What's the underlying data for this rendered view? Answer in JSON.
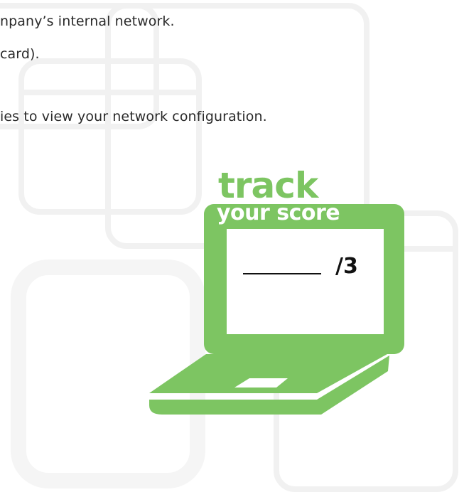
{
  "instructions": {
    "line1": "npany’s internal network.",
    "line2": "card).",
    "line3": "ies to view your network configuration."
  },
  "score_badge": {
    "title": "track",
    "subtitle": "your score",
    "total": "/3",
    "accent_color": "#7dc562"
  }
}
